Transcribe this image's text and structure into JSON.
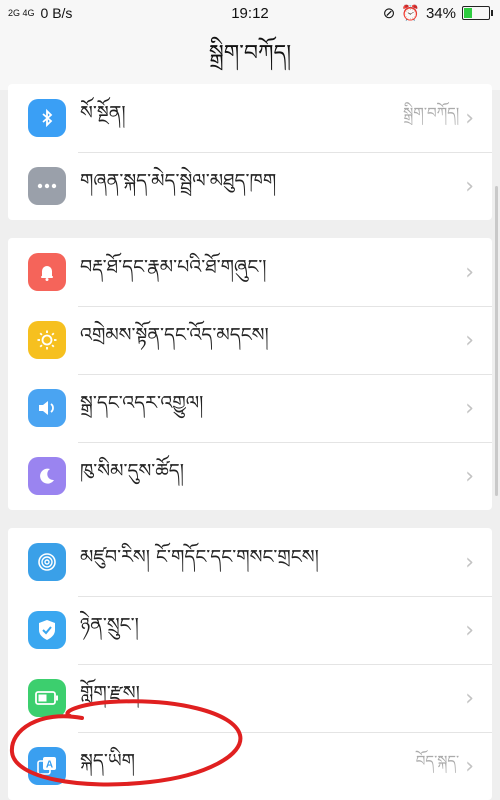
{
  "status_bar": {
    "network": "2G 4G",
    "speed": "0 B/s",
    "time": "19:12",
    "battery": "34%",
    "battery_level": 0.34
  },
  "header": {
    "title": "སྒྲིག་བཀོད།"
  },
  "groups": [
    {
      "items": [
        {
          "id": "bluetooth",
          "label": "སོ་སྔོན།",
          "value": "སྒྲིག་བཀོད།",
          "icon": "bluetooth-icon",
          "color": "#3a9ff5"
        },
        {
          "id": "more",
          "label": "གཞན་སྐད་མེད་སྦྲེལ་མཐུད་ཁག",
          "value": "",
          "icon": "more-dots-icon",
          "color": "#9aa0aa"
        }
      ]
    },
    {
      "items": [
        {
          "id": "notifications",
          "label": "བརྡ་ཐོ་དང་རྣམ་པའི་ཐོ་གཞུང་།",
          "value": "",
          "icon": "bell-icon",
          "color": "#f5645a"
        },
        {
          "id": "display",
          "label": "འགྲེམས་སྟོན་དང་འོད་མདངས།",
          "value": "",
          "icon": "brightness-icon",
          "color": "#f6c01f"
        },
        {
          "id": "sound",
          "label": "སྒྲ་དང་འདར་འགྱུལ།",
          "value": "",
          "icon": "speaker-icon",
          "color": "#4aa4f2"
        },
        {
          "id": "dnd",
          "label": "ཁུ་སིམ་དུས་ཚོད།",
          "value": "",
          "icon": "moon-icon",
          "color": "#9a84f0"
        }
      ]
    },
    {
      "items": [
        {
          "id": "fingerprint",
          "label": "མཛུབ་རིས། ངོ་གདོང་དང་གསང་གྲངས།",
          "value": "",
          "icon": "fingerprint-icon",
          "color": "#3aa0e8"
        },
        {
          "id": "security",
          "label": "ཉེན་སྲུང་།",
          "value": "",
          "icon": "shield-icon",
          "color": "#3aa7f0"
        },
        {
          "id": "battery",
          "label": "གློག་རྫས།",
          "value": "",
          "icon": "battery-icon",
          "color": "#3ccf6e"
        },
        {
          "id": "language",
          "label": "སྐད་ཡིག",
          "value": "བོད་སྐད་",
          "icon": "language-icon",
          "color": "#3a9ff0"
        }
      ]
    }
  ]
}
